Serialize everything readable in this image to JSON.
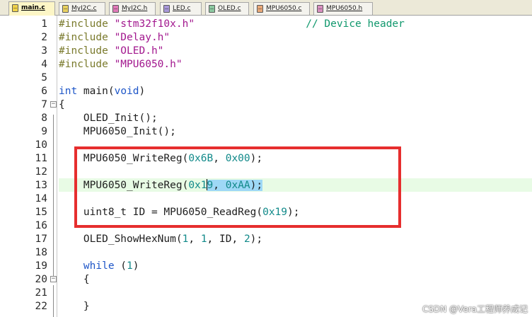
{
  "tabs": [
    {
      "label": "main.c",
      "active": true,
      "color": "#fdf6c6",
      "icon": "c-file-icon"
    },
    {
      "label": "MyI2C.c",
      "active": false,
      "color": "#f2edc4",
      "icon": "c-file-icon"
    },
    {
      "label": "MyI2C.h",
      "active": false,
      "color": "#f4d4e8",
      "icon": "h-file-icon"
    },
    {
      "label": "LED.c",
      "active": false,
      "color": "#e0dcf0",
      "icon": "c-file-icon"
    },
    {
      "label": "OLED.c",
      "active": false,
      "color": "#d9ebe0",
      "icon": "c-file-icon"
    },
    {
      "label": "MPU6050.c",
      "active": false,
      "color": "#f7e3d4",
      "icon": "c-file-icon"
    },
    {
      "label": "MPU6050.h",
      "active": false,
      "color": "#f0dde8",
      "icon": "h-file-icon"
    }
  ],
  "line_numbers": [
    "1",
    "2",
    "3",
    "4",
    "5",
    "6",
    "7",
    "8",
    "9",
    "10",
    "11",
    "12",
    "13",
    "14",
    "15",
    "16",
    "17",
    "18",
    "19",
    "20",
    "21",
    "22"
  ],
  "code": {
    "l1": {
      "directive": "#include",
      "file": "\"stm32f10x.h\"",
      "comment": "// Device header"
    },
    "l2": {
      "directive": "#include",
      "file": "\"Delay.h\""
    },
    "l3": {
      "directive": "#include",
      "file": "\"OLED.h\""
    },
    "l4": {
      "directive": "#include",
      "file": "\"MPU6050.h\""
    },
    "l6": {
      "kw_int": "int",
      "name": " main(",
      "kw_void": "void",
      "close": ")"
    },
    "l7": {
      "brace": "{"
    },
    "l8": {
      "text": "OLED_Init();"
    },
    "l9": {
      "text": "MPU6050_Init();"
    },
    "l11": {
      "fn": "MPU6050_WriteReg(",
      "arg1": "0x6B",
      "sep": ", ",
      "arg2": "0x00",
      "end": ");"
    },
    "l13": {
      "fn": "MPU6050_WriteReg(",
      "arg1_a": "0x1",
      "arg1_b": "9",
      "sep": ", ",
      "arg2": "0xAA",
      "end": ");"
    },
    "l15": {
      "decl": "uint8_t ID = MPU6050_ReadReg(",
      "arg": "0x19",
      "end": ");"
    },
    "l17": {
      "fn": "OLED_ShowHexNum(",
      "a1": "1",
      "c1": ", ",
      "a2": "1",
      "c2": ", ID, ",
      "a3": "2",
      "end": ");"
    },
    "l19": {
      "kw": "while",
      "open": " (",
      "num": "1",
      "close": ")"
    },
    "l20": {
      "brace": "{"
    },
    "l22": {
      "brace": "}"
    }
  },
  "watermark": "CSDN @Vera工程师养成记",
  "colors": {
    "preprocessor": "#7a7a2c",
    "string": "#a2178e",
    "keyword": "#1e56c8",
    "number": "#128a8a",
    "comment": "#10986d",
    "selection": "#9ed8f6",
    "current_line": "#e8fbe5",
    "annotation_box": "#e62e2e"
  }
}
